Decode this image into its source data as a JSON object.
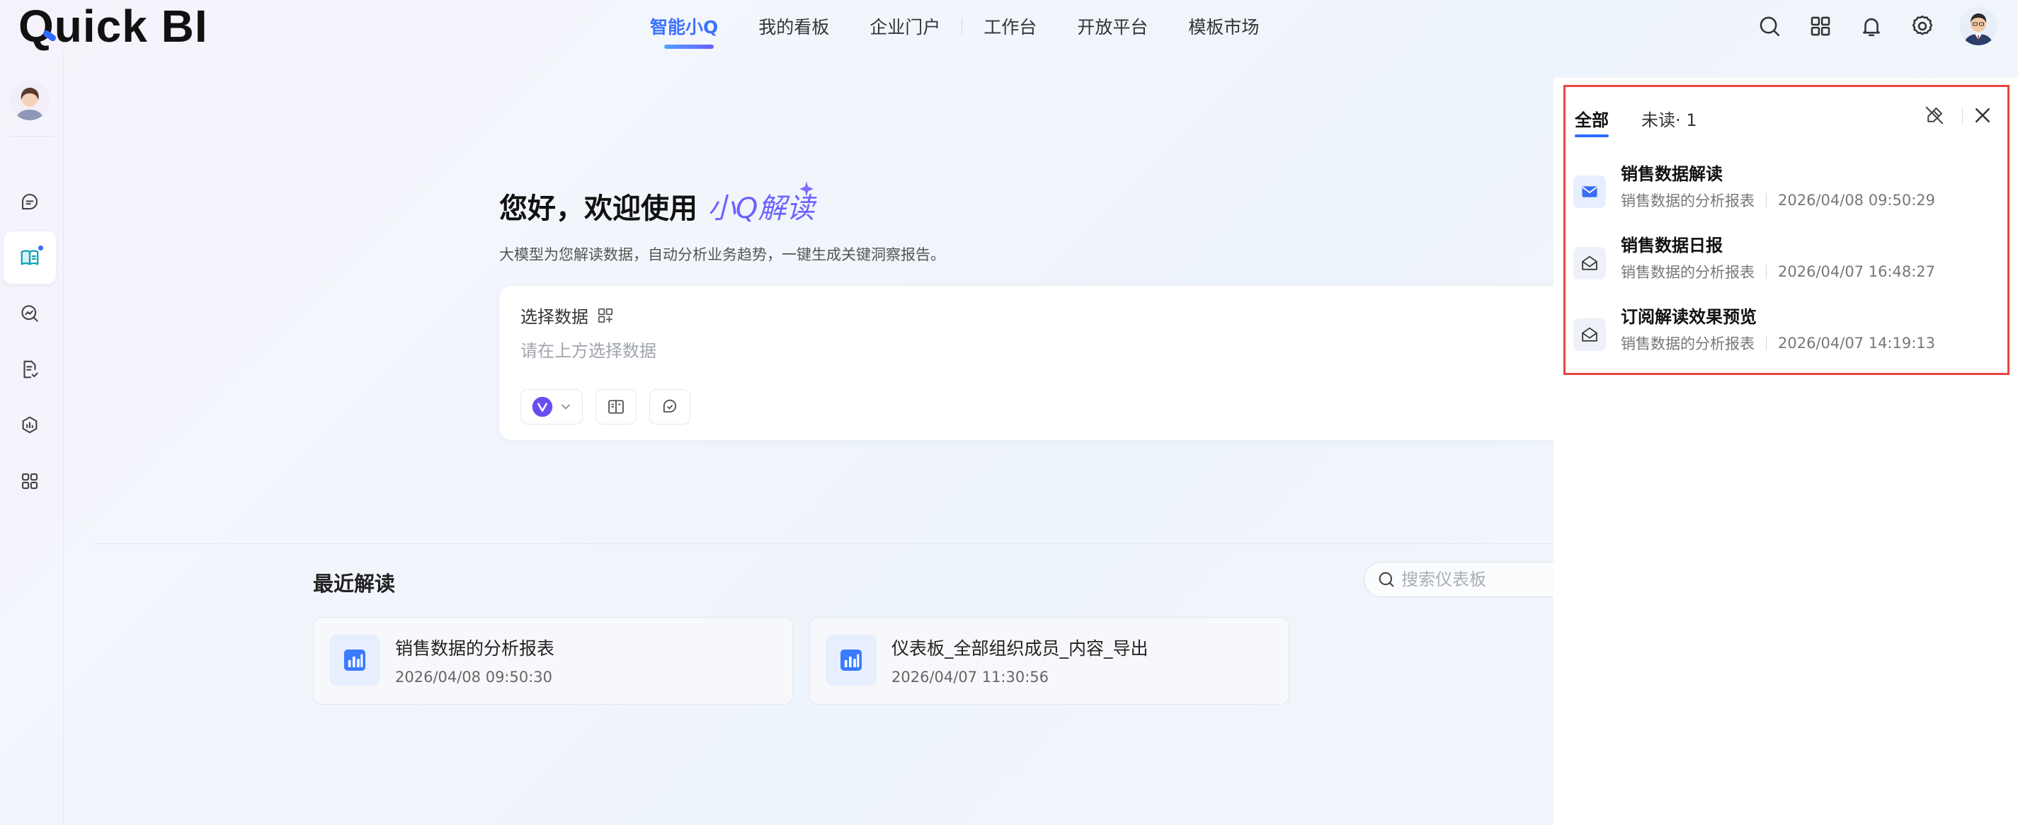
{
  "app": {
    "logo_text": "Quick BI"
  },
  "nav": {
    "items": [
      {
        "label": "智能小Q",
        "active": true
      },
      {
        "label": "我的看板"
      },
      {
        "label": "企业门户"
      },
      {
        "label": "工作台"
      },
      {
        "label": "开放平台"
      },
      {
        "label": "模板市场"
      }
    ]
  },
  "top_actions": [
    "search-icon",
    "app-grid-icon",
    "bell-icon",
    "gear-icon"
  ],
  "sidebar": {
    "items": [
      "chat-icon",
      "report-reader-icon",
      "insight-search-icon",
      "document-check-icon",
      "analysis-icon",
      "apps-icon"
    ],
    "active_index": 1
  },
  "welcome": {
    "title_prefix": "您好，欢迎使用",
    "title_brand": "小Q解读",
    "subtitle": "大模型为您解读数据，自动分析业务趋势，一键生成关键洞察报告。"
  },
  "ask_box": {
    "select_data_label": "选择数据",
    "placeholder": "请在上方选择数据"
  },
  "recent": {
    "title": "最近解读",
    "search_placeholder": "搜索仪表板",
    "cards": [
      {
        "name": "销售数据的分析报表",
        "time": "2026/04/08 09:50:30"
      },
      {
        "name": "仪表板_全部组织成员_内容_导出",
        "time": "2026/04/07 11:30:56"
      }
    ]
  },
  "notifications": {
    "tabs": {
      "all": "全部",
      "unread": "未读· 1"
    },
    "items": [
      {
        "title": "销售数据解读",
        "source": "销售数据的分析报表",
        "time": "2026/04/08 09:50:29",
        "unread": true
      },
      {
        "title": "销售数据日报",
        "source": "销售数据的分析报表",
        "time": "2026/04/07 16:48:27",
        "unread": false
      },
      {
        "title": "订阅解读效果预览",
        "source": "销售数据的分析报表",
        "time": "2026/04/07 14:19:13",
        "unread": false
      }
    ]
  },
  "colors": {
    "accent": "#3c72ff",
    "brand_purple": "#6b63ff",
    "highlight_frame": "#e5473f"
  }
}
